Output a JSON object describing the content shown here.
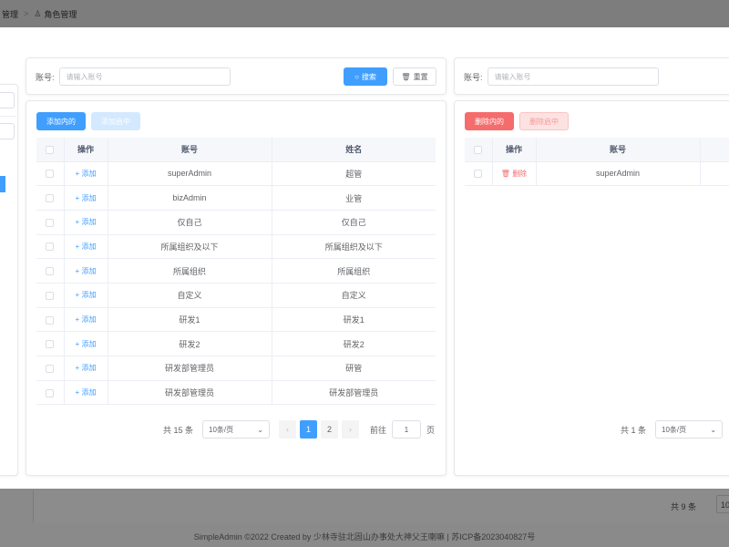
{
  "breadcrumb": {
    "parent": "管理",
    "current": "角色管理"
  },
  "left_search": {
    "account_label": "账号:",
    "account_placeholder": "请输入账号",
    "search_label": "搜索",
    "reset_label": "重置"
  },
  "left_toolbar": {
    "add_label": "添加内的",
    "adding_label": "添加启中"
  },
  "left_table": {
    "headers": [
      "操作",
      "账号",
      "姓名"
    ],
    "action_label": "添加",
    "rows": [
      {
        "account": "superAdmin",
        "name": "超管"
      },
      {
        "account": "bizAdmin",
        "name": "业管"
      },
      {
        "account": "仅自己",
        "name": "仅自己"
      },
      {
        "account": "所属组织及以下",
        "name": "所属组织及以下"
      },
      {
        "account": "所属组织",
        "name": "所属组织"
      },
      {
        "account": "自定义",
        "name": "自定义"
      },
      {
        "account": "研发1",
        "name": "研发1"
      },
      {
        "account": "研发2",
        "name": "研发2"
      },
      {
        "account": "研发部管理员",
        "name": "研管"
      },
      {
        "account": "研发部管理员",
        "name": "研发部管理员"
      }
    ]
  },
  "left_pager": {
    "total": "共 15 条",
    "page_size": "10条/页",
    "prev": "‹",
    "pages": [
      "1",
      "2"
    ],
    "next": "›",
    "goto_label": "前往",
    "goto_value": "1",
    "page_unit": "页"
  },
  "right_search": {
    "account_label": "账号:",
    "account_placeholder": "请输入账号"
  },
  "right_toolbar": {
    "delete_label": "删除内的",
    "deleting_label": "删除启中"
  },
  "right_table": {
    "headers": [
      "操作",
      "账号"
    ],
    "action_label": "删除",
    "rows": [
      {
        "account": "superAdmin"
      }
    ]
  },
  "right_pager": {
    "total": "共 1 条",
    "page_size": "10条/页"
  },
  "background": {
    "count_text": "共 9 条",
    "size_text": "10",
    "footer": "SimpleAdmin ©2022 Created by 少林寺驻北固山办事处大神父王喇嘛 | 苏ICP备2023040827号"
  },
  "colors": {
    "primary": "#409eff",
    "danger": "#f56c6c",
    "overlay": "#8c8c8c"
  },
  "icons": {
    "search": "search-icon",
    "reset": "trash-icon",
    "add": "plus-icon",
    "delete": "trash-icon",
    "user": "user-icon"
  }
}
